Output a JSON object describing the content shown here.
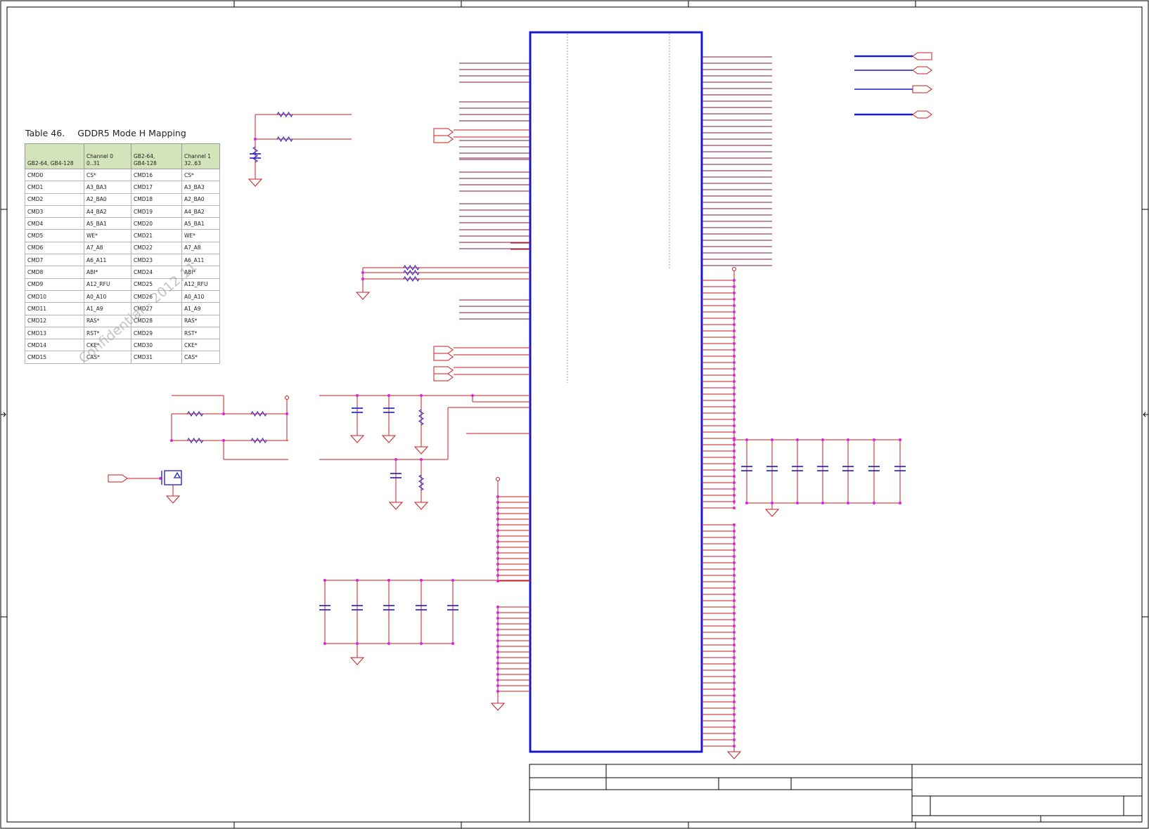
{
  "table": {
    "caption_number": "Table 46.",
    "caption_title": "GDDR5 Mode H Mapping",
    "headers": [
      "GB2-64, GB4-128",
      "Channel 0\n0..31",
      "GB2-64,\nGB4-128",
      "Channel 1\n32..63"
    ],
    "rows": [
      [
        "CMD0",
        "CS*",
        "CMD16",
        "CS*"
      ],
      [
        "CMD1",
        "A3_BA3",
        "CMD17",
        "A3_BA3"
      ],
      [
        "CMD2",
        "A2_BA0",
        "CMD18",
        "A2_BA0"
      ],
      [
        "CMD3",
        "A4_BA2",
        "CMD19",
        "A4_BA2"
      ],
      [
        "CMD4",
        "A5_BA1",
        "CMD20",
        "A5_BA1"
      ],
      [
        "CMD5",
        "WE*",
        "CMD21",
        "WE*"
      ],
      [
        "CMD6",
        "A7_A8",
        "CMD22",
        "A7_A8"
      ],
      [
        "CMD7",
        "A6_A11",
        "CMD23",
        "A6_A11"
      ],
      [
        "CMD8",
        "ABI*",
        "CMD24",
        "ABI*"
      ],
      [
        "CMD9",
        "A12_RFU",
        "CMD25",
        "A12_RFU"
      ],
      [
        "CMD10",
        "A0_A10",
        "CMD26",
        "A0_A10"
      ],
      [
        "CMD11",
        "A1_A9",
        "CMD27",
        "A1_A9"
      ],
      [
        "CMD12",
        "RAS*",
        "CMD28",
        "RAS*"
      ],
      [
        "CMD13",
        "RST*",
        "CMD29",
        "RST*"
      ],
      [
        "CMD14",
        "CKE*",
        "CMD30",
        "CKE*"
      ],
      [
        "CMD15",
        "CAS*",
        "CMD31",
        "CAS*"
      ]
    ]
  },
  "watermark": "Confidential - 2012.11",
  "colors": {
    "wire": "#cc1c1c",
    "bus": "#7a1a4a",
    "symbol": "#1a1acc",
    "junction": "#e020e0",
    "border": "#000000",
    "table_header_bg": "#d3e4bb"
  },
  "icons": [
    "resistor-icon",
    "capacitor-icon",
    "ground-icon",
    "power-port-icon",
    "offpage-connector-icon",
    "mosfet-icon"
  ]
}
